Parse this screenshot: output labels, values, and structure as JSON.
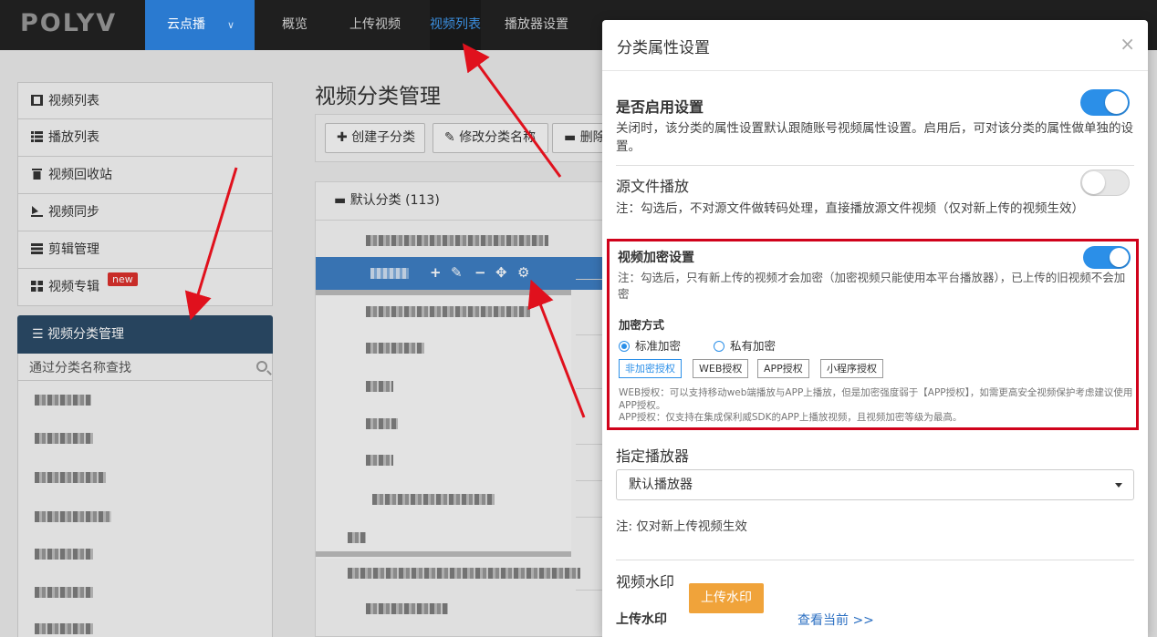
{
  "nav": {
    "logo": "POLYV",
    "product": "云点播",
    "items": [
      "概览",
      "上传视频",
      "视频列表",
      "播放器设置"
    ],
    "active": "视频列表"
  },
  "sidebar": {
    "items": [
      {
        "label": "视频列表",
        "icon": "film-icon"
      },
      {
        "label": "播放列表",
        "icon": "list-icon"
      },
      {
        "label": "视频回收站",
        "icon": "trash-icon"
      },
      {
        "label": "视频同步",
        "icon": "sync-icon"
      },
      {
        "label": "剪辑管理",
        "icon": "server-icon"
      },
      {
        "label": "视频专辑",
        "icon": "grid-icon",
        "badge": "new"
      }
    ],
    "category_panel": {
      "title": "视频分类管理",
      "search_placeholder": "通过分类名称查找"
    }
  },
  "main": {
    "title": "视频分类管理",
    "toolbar": {
      "create": "创建子分类",
      "rename": "修改分类名称",
      "delete": "删除"
    },
    "tree_root": "默认分类 (113)"
  },
  "modal": {
    "title": "分类属性设置",
    "close": "×",
    "enable": {
      "title": "是否启用设置",
      "desc": "关闭时，该分类的属性设置默认跟随账号视频属性设置。启用后，可对该分类的属性做单独的设置。",
      "on": true
    },
    "source": {
      "title": "源文件播放",
      "desc": "注：勾选后，不对源文件做转码处理，直接播放源文件视频（仅对新上传的视频生效）",
      "on": false
    },
    "encrypt": {
      "title": "视频加密设置",
      "note": "注：勾选后，只有新上传的视频才会加密（加密视频只能使用本平台播放器），已上传的旧视频不会加密",
      "method_label": "加密方式",
      "radio_standard": "标准加密",
      "radio_private": "私有加密",
      "auth_buttons": [
        "非加密授权",
        "WEB授权",
        "APP授权",
        "小程序授权"
      ],
      "web_note": "WEB授权：可以支持移动web端播放与APP上播放，但是加密强度弱于【APP授权】，如需更高安全视频保护考虑建议使用APP授权。",
      "app_note": "APP授权：仅支持在集成保利威SDK的APP上播放视频，且视频加密等级为最高。",
      "on": true
    },
    "player": {
      "title": "指定播放器",
      "selected": "默认播放器",
      "note": "注: 仅对新上传视频生效"
    },
    "watermark": {
      "title": "视频水印",
      "upload_label": "上传水印",
      "upload_button": "上传水印",
      "view_link": "查看当前 >>"
    }
  }
}
